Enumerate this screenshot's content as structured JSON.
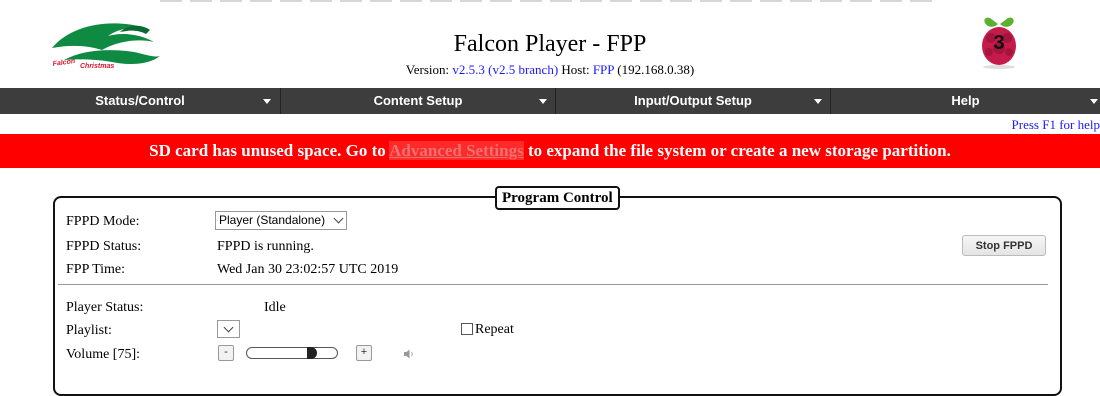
{
  "header": {
    "title": "Falcon Player - FPP",
    "version_label": "Version:",
    "version_value": "v2.5.3 (v2.5 branch)",
    "host_label": "Host:",
    "host_name": "FPP",
    "host_ip": "(192.168.0.38)",
    "logo_text": "Falcon Christmas",
    "pi_badge": "3"
  },
  "nav": {
    "items": [
      {
        "label": "Status/Control"
      },
      {
        "label": "Content Setup"
      },
      {
        "label": "Input/Output Setup"
      },
      {
        "label": "Help"
      }
    ]
  },
  "help_hint": "Press F1 for help",
  "banner": {
    "prefix": "SD card has unused space. Go to",
    "link": "Advanced Settings",
    "suffix": "to expand the file system or create a new storage partition."
  },
  "program_control": {
    "legend": "Program Control",
    "fppd_mode_label": "FPPD Mode:",
    "fppd_mode_value": "Player (Standalone)",
    "fppd_status_label": "FPPD Status:",
    "fppd_status_value": "FPPD is running.",
    "fpp_time_label": "FPP Time:",
    "fpp_time_value": "Wed Jan 30 23:02:57 UTC 2019",
    "stop_button": "Stop FPPD",
    "player_status_label": "Player Status:",
    "player_status_value": "Idle",
    "playlist_label": "Playlist:",
    "repeat_label": "Repeat",
    "volume_label": "Volume [75]:",
    "volume_minus": "-",
    "volume_plus": "+",
    "volume_level": 0.75
  },
  "colors": {
    "nav_bg": "#3d3d3d",
    "banner_bg": "#ff0000",
    "link": "#1a1aff",
    "logo_green": "#0f8a43",
    "logo_red": "#d8142e",
    "pi_red": "#c51a4a",
    "pi_green": "#5bb02f"
  },
  "icons": {
    "logo": "falcon-christmas-logo",
    "pi": "raspberry-pi-icon",
    "speaker": "speaker-icon"
  }
}
